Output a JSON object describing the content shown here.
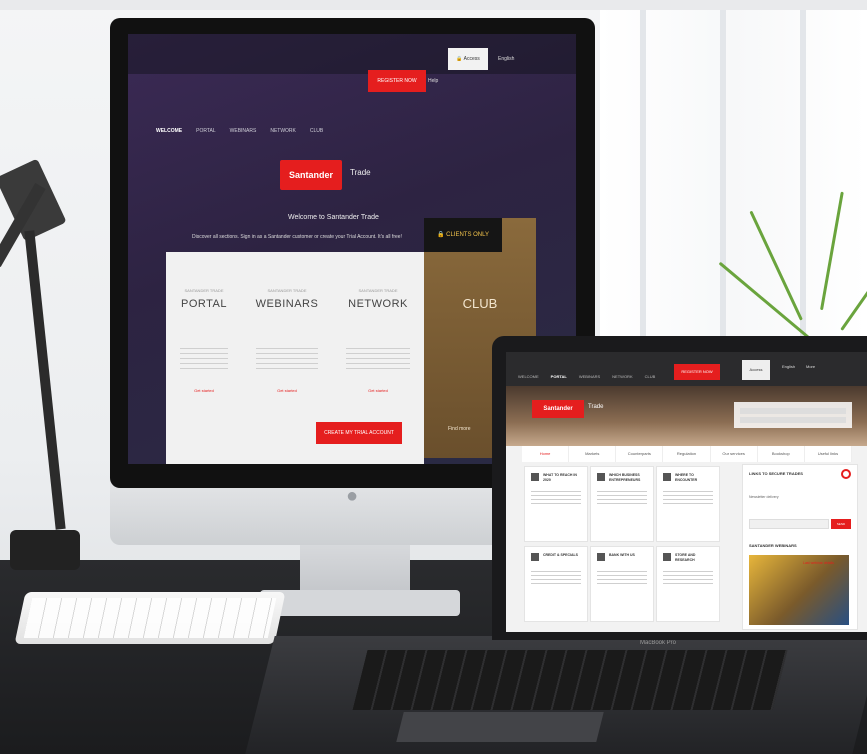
{
  "imac": {
    "top_bar": {
      "register_button": "REGISTER NOW",
      "help": "Help",
      "access_button": "Access",
      "language": "English"
    },
    "nav": [
      "WELCOME",
      "PORTAL",
      "WEBINARS",
      "NETWORK",
      "CLUB"
    ],
    "brand": "Santander",
    "brand_sub": "Trade",
    "welcome": "Welcome to Santander Trade",
    "subline": "Discover all sections. Sign in as a Santander customer or create your Trial Account. It's all free!",
    "panels": [
      {
        "kicker": "SANTANDER TRADE",
        "title": "PORTAL",
        "link": "Get started"
      },
      {
        "kicker": "SANTANDER TRADE",
        "title": "WEBINARS",
        "link": "Get started"
      },
      {
        "kicker": "SANTANDER TRADE",
        "title": "NETWORK",
        "link": "Get started"
      }
    ],
    "club_badge": "CLIENTS ONLY",
    "club_title": "CLUB",
    "club_link": "Find more",
    "trial_button": "CREATE MY TRIAL ACCOUNT"
  },
  "laptop": {
    "top_bar": {
      "register_button": "REGISTER NOW",
      "access_button": "Access",
      "language": "English",
      "more": "More"
    },
    "nav": [
      "WELCOME",
      "PORTAL",
      "WEBINARS",
      "NETWORK",
      "CLUB"
    ],
    "brand": "Santander",
    "brand_sub": "Trade",
    "tabs": [
      "Home",
      "Markets",
      "Counterparts",
      "Regulation",
      "Our services",
      "Bookshop",
      "Useful links"
    ],
    "tiles": [
      {
        "title": "WHAT TO REACH IN 2020",
        "icon": "doc-icon"
      },
      {
        "title": "WHICH BUSINESS ENTREPRENEURS",
        "icon": "building-icon"
      },
      {
        "title": "WHERE TO ENCOUNTER",
        "icon": "factory-icon"
      },
      {
        "title": "CREDIT & SPECIALS",
        "icon": "card-icon"
      },
      {
        "title": "BANK WITH US",
        "icon": "plane-icon"
      },
      {
        "title": "STORE AND RESEARCH",
        "icon": "factory-icon"
      }
    ],
    "side": {
      "header": "LINKS TO SECURE TRADES",
      "subtitle": "Newsletter delivery",
      "button": "SEND",
      "header2": "SANTANDER WEBINARS",
      "image_caption": "Last webinar details"
    },
    "base_label": "MacBook Pro"
  },
  "colors": {
    "brand_red": "#e51e1e",
    "screen_purple": "#3b2a55",
    "club_gold": "#8a6a3c",
    "desk": "#1b1c1e"
  }
}
